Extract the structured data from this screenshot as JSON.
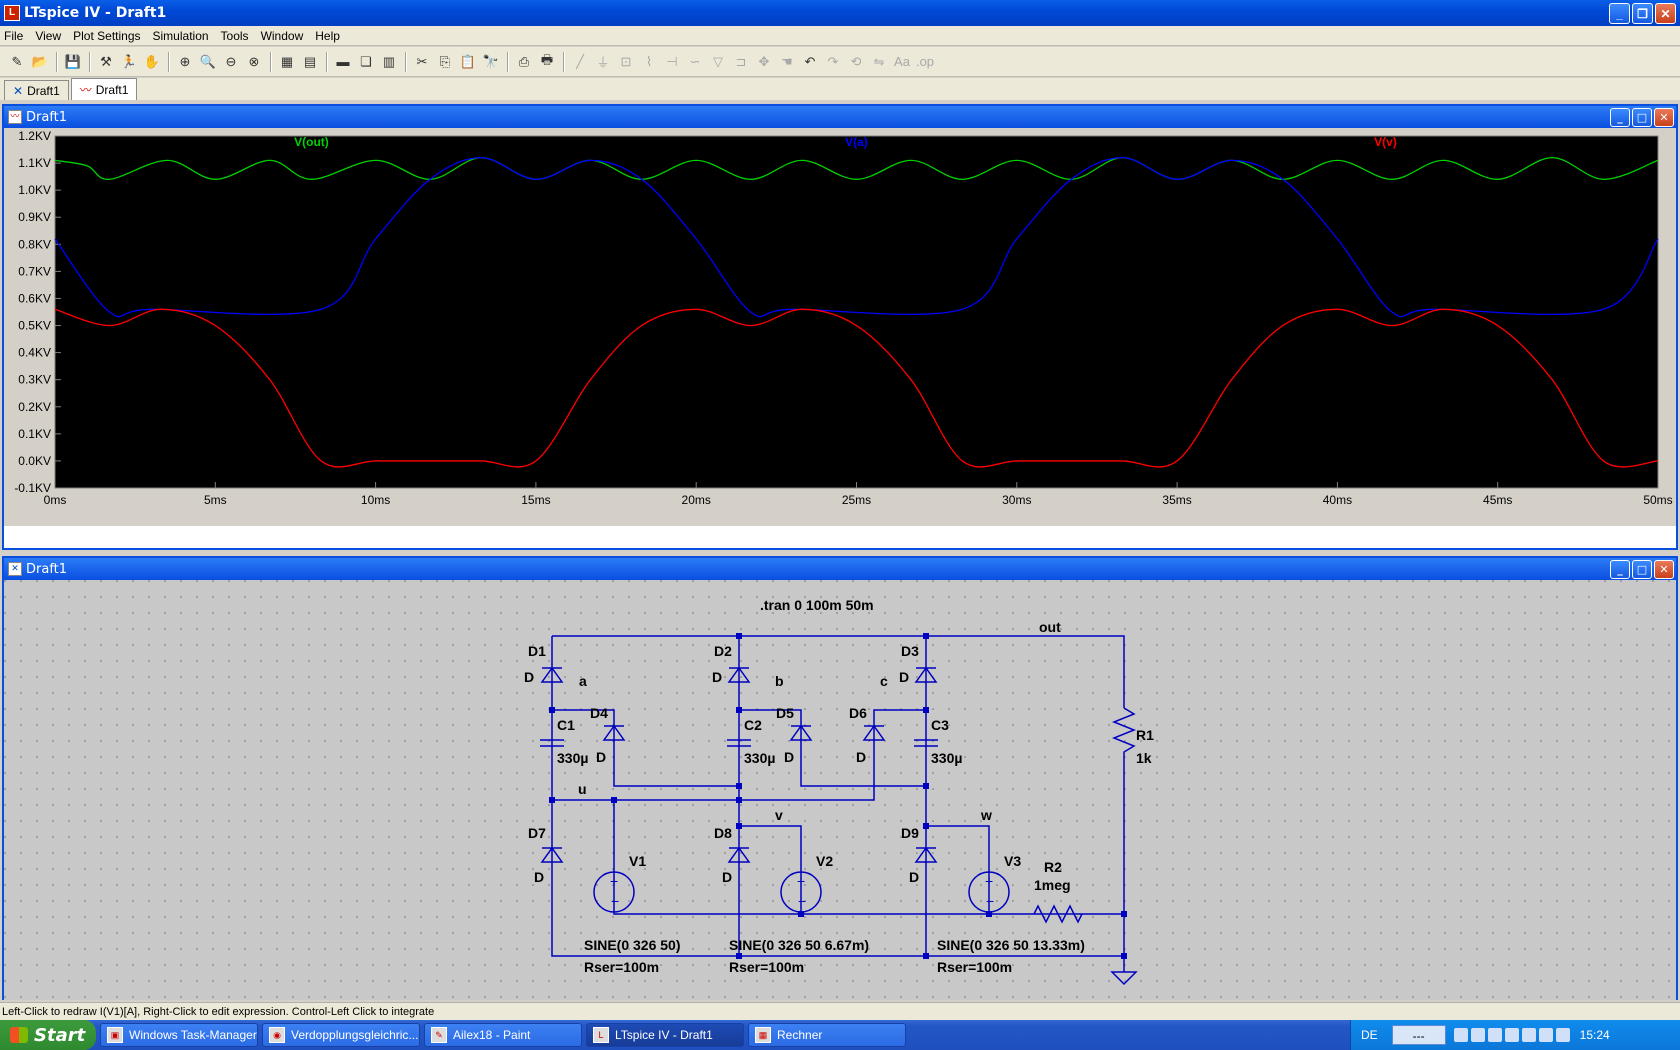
{
  "app": {
    "title": "LTspice IV - Draft1",
    "icon": "ltspice-icon"
  },
  "window_buttons": {
    "minimize": "_",
    "restore": "❐",
    "close": "✕"
  },
  "menu": [
    {
      "label": "File"
    },
    {
      "label": "View"
    },
    {
      "label": "Plot Settings"
    },
    {
      "label": "Simulation"
    },
    {
      "label": "Tools"
    },
    {
      "label": "Window"
    },
    {
      "label": "Help"
    }
  ],
  "tabs": [
    {
      "label": "Draft1",
      "icon": "schematic-icon"
    },
    {
      "label": "Draft1",
      "icon": "waveform-icon"
    }
  ],
  "plot_window": {
    "title": "Draft1",
    "traces": [
      {
        "name": "V(out)",
        "color": "#00d000"
      },
      {
        "name": "V(a)",
        "color": "#0000ff"
      },
      {
        "name": "V(v)",
        "color": "#ff0000"
      }
    ],
    "y_ticks": [
      "1.2KV",
      "1.1KV",
      "1.0KV",
      "0.9KV",
      "0.8KV",
      "0.7KV",
      "0.6KV",
      "0.5KV",
      "0.4KV",
      "0.3KV",
      "0.2KV",
      "0.1KV",
      "0.0KV",
      "-0.1KV"
    ],
    "x_ticks": [
      "0ms",
      "5ms",
      "10ms",
      "15ms",
      "20ms",
      "25ms",
      "30ms",
      "35ms",
      "40ms",
      "45ms",
      "50ms"
    ]
  },
  "chart_data": {
    "type": "line",
    "xlabel": "",
    "ylabel": "",
    "xlim": [
      0,
      50
    ],
    "ylim": [
      -0.1,
      1.2
    ],
    "x_unit": "ms",
    "y_unit": "KV",
    "grid": false,
    "series": [
      {
        "name": "V(out)",
        "color": "#00d000",
        "x": [
          0,
          1,
          1.7,
          3.5,
          5,
          6.7,
          8,
          10,
          11.7,
          13.3,
          15,
          16.7,
          18.3,
          20,
          21.7,
          23.3,
          25,
          26.7,
          28.3,
          30,
          31.7,
          33.3,
          35,
          36.7,
          38.3,
          40,
          41.7,
          43.3,
          45,
          46.7,
          48.3,
          50
        ],
        "y": [
          1.11,
          1.09,
          1.04,
          1.11,
          1.04,
          1.11,
          1.04,
          1.11,
          1.04,
          1.12,
          1.04,
          1.11,
          1.04,
          1.11,
          1.04,
          1.11,
          1.04,
          1.11,
          1.04,
          1.11,
          1.04,
          1.12,
          1.04,
          1.11,
          1.04,
          1.11,
          1.04,
          1.11,
          1.04,
          1.12,
          1.04,
          1.11
        ]
      },
      {
        "name": "V(a)",
        "color": "#0000ff",
        "x": [
          0,
          1.7,
          3,
          8.3,
          10,
          11.7,
          13.3,
          15,
          16.7,
          18.3,
          20,
          21.7,
          23,
          28.3,
          30,
          31.7,
          33.3,
          35,
          36.7,
          38.3,
          40,
          41.7,
          43,
          48.3,
          50
        ],
        "y": [
          0.82,
          0.55,
          0.56,
          0.56,
          0.82,
          1.04,
          1.12,
          1.04,
          1.11,
          1.04,
          0.82,
          0.55,
          0.56,
          0.56,
          0.82,
          1.04,
          1.12,
          1.04,
          1.11,
          1.04,
          0.82,
          0.55,
          0.56,
          0.56,
          0.82
        ]
      },
      {
        "name": "V(v)",
        "color": "#ff0000",
        "x": [
          0,
          1.7,
          3.3,
          5,
          6.7,
          8.3,
          10,
          11.7,
          13.3,
          15,
          16.7,
          18.3,
          20,
          21.7,
          23.3,
          25,
          26.7,
          28.3,
          30,
          31.7,
          33.3,
          35,
          36.7,
          38.3,
          40,
          41.7,
          43.3,
          45,
          46.7,
          48.3,
          50
        ],
        "y": [
          0.56,
          0.5,
          0.56,
          0.5,
          0.3,
          0.0,
          0.0,
          0.0,
          0.0,
          0.0,
          0.3,
          0.5,
          0.56,
          0.5,
          0.56,
          0.5,
          0.3,
          0.0,
          0.0,
          0.0,
          0.0,
          0.0,
          0.3,
          0.5,
          0.56,
          0.5,
          0.56,
          0.5,
          0.3,
          0.0,
          0.0
        ]
      }
    ]
  },
  "schematic_window": {
    "title": "Draft1",
    "directive": ".tran 0 100m 50m",
    "labels": {
      "out": "out",
      "a": "a",
      "b": "b",
      "c": "c",
      "u": "u",
      "v": "v",
      "w": "w",
      "D1": "D1",
      "D2": "D2",
      "D3": "D3",
      "D4": "D4",
      "D5": "D5",
      "D6": "D6",
      "D7": "D7",
      "D8": "D8",
      "D9": "D9",
      "D": "D",
      "C1": "C1",
      "C2": "C2",
      "C3": "C3",
      "cap_val": "330µ",
      "R1": "R1",
      "R1_val": "1k",
      "R2": "R2",
      "R2_val": "1meg",
      "V1": "V1",
      "V2": "V2",
      "V3": "V3",
      "V1_spec": "SINE(0 326 50)",
      "V2_spec": "SINE(0 326 50 6.67m)",
      "V3_spec": "SINE(0 326 50 13.33m)",
      "rser": "Rser=100m"
    }
  },
  "status": "Left-Click to redraw I(V1)[A],  Right-Click to edit expression. Control-Left Click to integrate",
  "taskbar": {
    "start": "Start",
    "tasks": [
      {
        "label": "Windows Task-Manager",
        "active": false
      },
      {
        "label": "Verdopplungsgleichric...",
        "active": false
      },
      {
        "label": "Ailex18 - Paint",
        "active": false
      },
      {
        "label": "LTspice IV - Draft1",
        "active": true
      },
      {
        "label": "Rechner",
        "active": false
      }
    ],
    "lang": "DE",
    "input": "---",
    "clock": "15:24"
  }
}
